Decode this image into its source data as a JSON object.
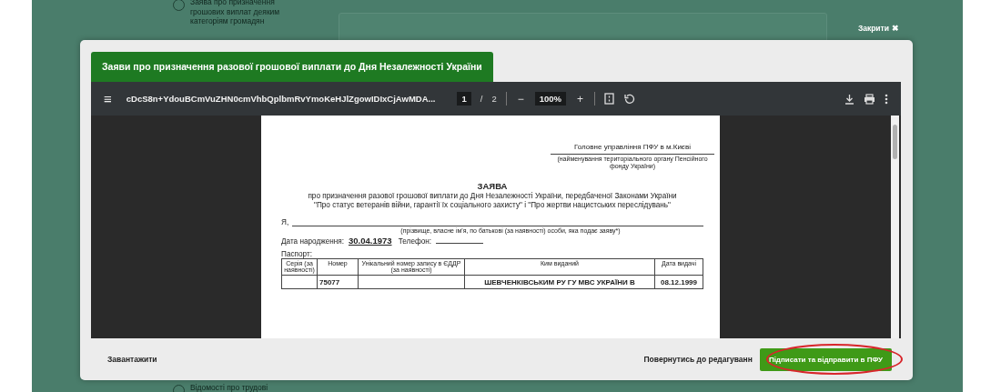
{
  "background": {
    "sidebar_items": [
      {
        "label": "Заява про призначення грошових виплат деяким категоріям громадян"
      },
      {
        "label": "Відомості про трудові"
      }
    ],
    "close_label": "Закрити",
    "close_glyph": "✖"
  },
  "modal": {
    "tab_title": "Заяви про призначення разової грошової виплати до Дня Незалежності України",
    "viewer": {
      "file_name": "cDcS8n+YdouBCmVuZHN0cmVhbQplbmRvYmoKeHJlZgowIDIxCjAwMDA...",
      "menu_glyph": "≡",
      "page_current": "1",
      "page_separator": "/",
      "page_total": "2",
      "zoom_out": "−",
      "zoom": "100%",
      "zoom_in": "+"
    },
    "document": {
      "authority": "Головне управління ПФУ в м.Києві",
      "authority_caption": "(найменування територіального органу Пенсійного фонду України)",
      "title": "ЗАЯВА",
      "subtitle": "про призначення разової грошової виплати до Дня Незалежності України, передбаченої Законами України \"Про статус ветеранів війни, гарантії їх соціального захисту\" і \"Про жертви нацистських переслідувань\"",
      "applicant_label": "Я,",
      "applicant_caption": "(прізвище, власне ім'я, по батькові (за наявності) особи, яка подає заяву*)",
      "birth_label": "Дата народження:",
      "birth_date": "30.04.1973",
      "phone_label": "Телефон:",
      "passport_label": "Паспорт:",
      "passport_columns": [
        "Серія (за наявності)",
        "Номер",
        "Унікальний номер запису в ЄДДР (за наявності)",
        "Ким виданий",
        "Дата видачі"
      ],
      "passport_row": {
        "number": "75077",
        "issued_by": "ШЕВЧЕНКІВСЬКИМ РУ ГУ МВС УКРАЇНИ В",
        "issue_date": "08.12.1999"
      }
    },
    "footer": {
      "download": "Завантажити",
      "back": "Повернутись до редагуванн",
      "submit": "Підписати та відправити в ПФУ",
      "submit_highlighted": true
    }
  }
}
